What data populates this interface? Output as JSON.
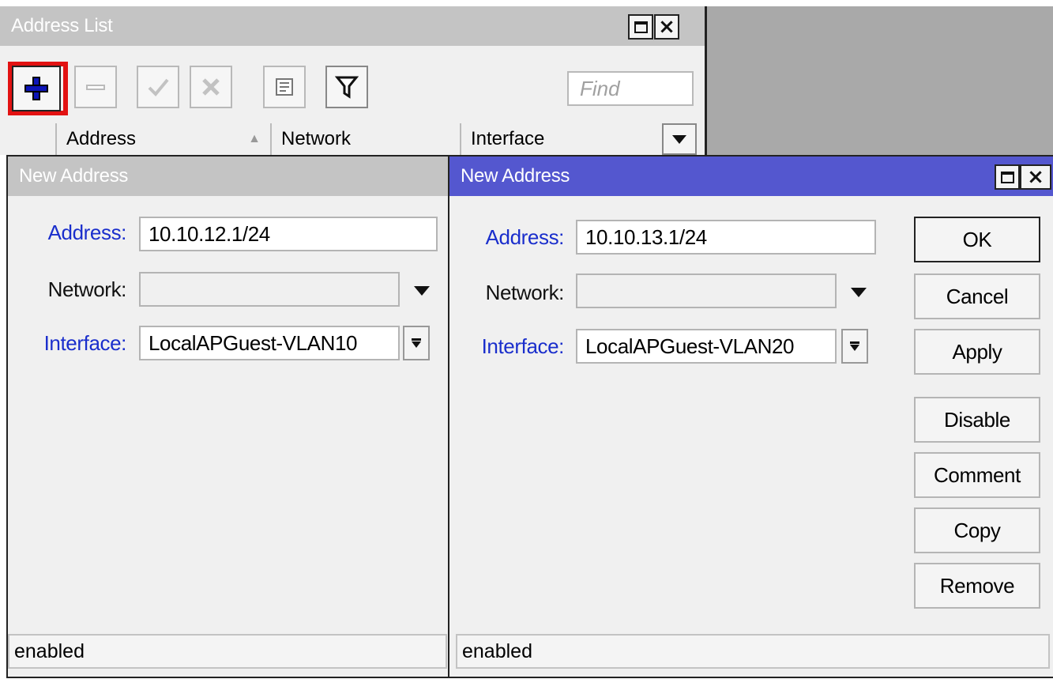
{
  "address_list": {
    "title": "Address List",
    "find_placeholder": "Find",
    "columns": [
      "Address",
      "Network",
      "Interface"
    ]
  },
  "dialog_inactive": {
    "title": "New Address",
    "address_label": "Address:",
    "address_value": "10.10.12.1/24",
    "network_label": "Network:",
    "network_value": "",
    "interface_label": "Interface:",
    "interface_value": "LocalAPGuest-VLAN10",
    "status": "enabled"
  },
  "dialog_active": {
    "title": "New Address",
    "address_label": "Address:",
    "address_value": "10.10.13.1/24",
    "network_label": "Network:",
    "network_value": "",
    "interface_label": "Interface:",
    "interface_value": "LocalAPGuest-VLAN20",
    "status": "enabled",
    "buttons": {
      "ok": "OK",
      "cancel": "Cancel",
      "apply": "Apply",
      "disable": "Disable",
      "comment": "Comment",
      "copy": "Copy",
      "remove": "Remove"
    }
  },
  "icons": {
    "add": "plus-icon",
    "remove": "minus-icon",
    "enable": "check-icon",
    "disable": "cross-icon",
    "comment": "note-icon",
    "filter": "funnel-icon"
  },
  "colors": {
    "active_title": "#5457cf",
    "inactive_title": "#c4c4c4",
    "label_blue": "#1a2ecc",
    "highlight_red": "#e21212"
  }
}
